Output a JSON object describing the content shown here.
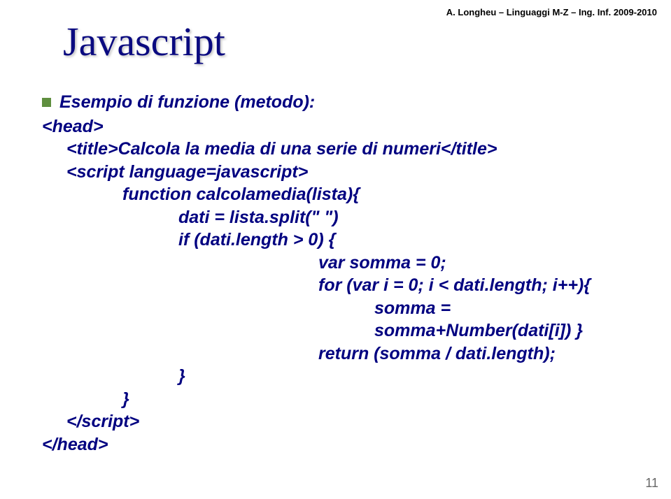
{
  "header": "A. Longheu – Linguaggi M-Z – Ing. Inf.  2009-2010",
  "title": "Javascript",
  "bullet_text": "Esempio di funzione (metodo):",
  "code": {
    "l01": "<head>",
    "l02": "<title>Calcola la media di una serie di numeri</title>",
    "l03": "<script language=javascript>",
    "l04": "function calcolamedia(lista){",
    "l05": "dati = lista.split(\" \")",
    "l06": "if (dati.length > 0) {",
    "l07": "var somma = 0;",
    "l08": "for (var i = 0; i < dati.length; i++){",
    "l09": "somma = somma+Number(dati[i]) }",
    "l10": "return (somma / dati.length);",
    "l11": "}",
    "l12": "}",
    "l13": "</script>",
    "l14": "</head>"
  },
  "page_number": "11"
}
